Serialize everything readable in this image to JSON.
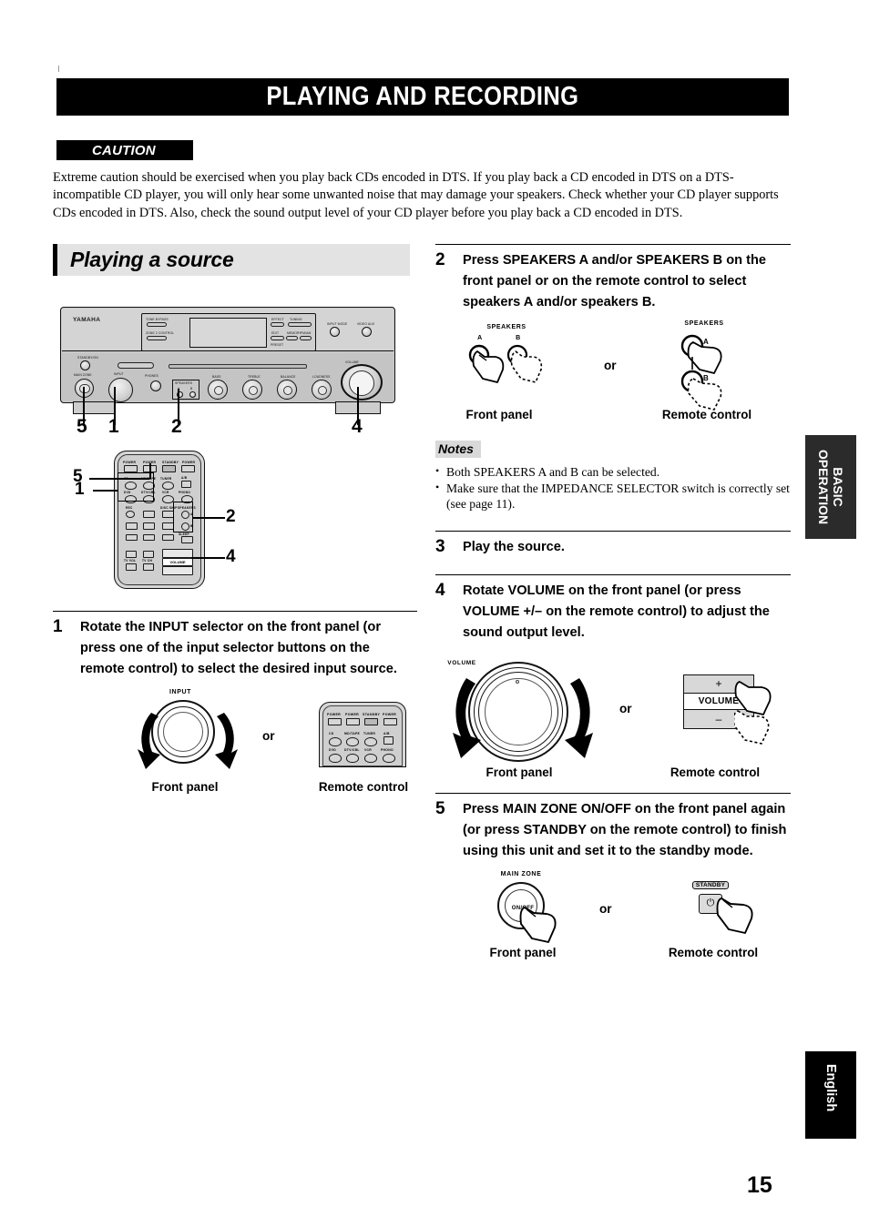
{
  "document": {
    "title": "PLAYING AND RECORDING",
    "page_number": "15"
  },
  "caution": {
    "label": "CAUTION",
    "body": "Extreme caution should be exercised when you play back CDs encoded in DTS. If you play back a CD encoded in DTS on a DTS-incompatible CD player, you will only hear some unwanted noise that may damage your speakers. Check whether your CD player supports CDs encoded in DTS. Also, check the sound output level of your CD player before you play back a CD encoded in DTS."
  },
  "section": {
    "heading": "Playing a source"
  },
  "receiver_figure": {
    "brand": "YAMAHA",
    "labels": {
      "standby_on": "STANDBY/ON",
      "main_zone": "MAIN ZONE",
      "on_off": "ON/OFF",
      "input": "INPUT",
      "phones": "PHONES",
      "speakers": "SPEAKERS",
      "speakers_a": "A",
      "speakers_b": "B",
      "bass": "BASS",
      "treble": "TREBLE",
      "balance": "BALANCE",
      "loudness": "LOUDNESS",
      "volume": "VOLUME",
      "input_mode": "INPUT MODE",
      "video_aux": "VIDEO AUX",
      "effect": "EFFECT",
      "memory": "MEMORY",
      "tuning": "TUNING",
      "preset": "PRESET",
      "edit": "EDIT",
      "fm_am": "FM/AM",
      "tone_bypass": "TONE BYPASS",
      "zone2_control": "ZONE 2 CONTROL"
    },
    "callouts": [
      "5",
      "1",
      "2",
      "4"
    ]
  },
  "remote_figure": {
    "callouts": [
      "5",
      "1",
      "2",
      "4"
    ],
    "buttons": {
      "power": "POWER",
      "tv": "TV",
      "av": "AV",
      "standby": "STANDBY",
      "power_unit": "POWER",
      "cd": "CD",
      "md_tape": "MD/TAPE",
      "tuner": "TUNER",
      "a_b": "A/B",
      "dvd": "DVD",
      "dtv_cbl": "DTV/CBL",
      "vcr": "VCR",
      "phono": "PHONO",
      "rec": "REC",
      "disc_skip": "DISC SKIP",
      "speakers": "SPEAKERS",
      "sleep": "SLEEP",
      "volume": "VOLUME",
      "tv_vol": "TV VOL",
      "tv_ch": "TV CH"
    }
  },
  "steps": [
    {
      "number": "1",
      "text": "Rotate the INPUT selector on the front panel (or press one of the input selector buttons on the remote control) to select the desired input source.",
      "figure": {
        "knob_label": "INPUT",
        "front_caption": "Front panel",
        "remote_caption": "Remote control",
        "or": "or"
      }
    },
    {
      "number": "2",
      "text": "Press SPEAKERS A and/or SPEAKERS B on the front panel or on the remote control to select speakers A and/or speakers B.",
      "figure": {
        "speakers_label": "SPEAKERS",
        "a": "A",
        "b": "B",
        "front_caption": "Front panel",
        "remote_caption": "Remote control",
        "or": "or"
      }
    },
    {
      "number": "3",
      "text": "Play the source."
    },
    {
      "number": "4",
      "text": "Rotate VOLUME on the front panel (or press VOLUME +/– on the remote control) to adjust the sound output level.",
      "figure": {
        "knob_label": "VOLUME",
        "plus": "+",
        "minus": "–",
        "rocker_label": "VOLUME",
        "front_caption": "Front panel",
        "remote_caption": "Remote control",
        "or": "or"
      }
    },
    {
      "number": "5",
      "text": "Press MAIN ZONE ON/OFF on the front panel again (or press STANDBY on the remote control) to finish using this unit and set it to the standby mode.",
      "figure": {
        "main_zone": "MAIN ZONE",
        "on_off": "ON/OFF",
        "standby": "STANDBY",
        "power_glyph": "⏻",
        "front_caption": "Front panel",
        "remote_caption": "Remote control",
        "or": "or"
      }
    }
  ],
  "notes": {
    "label": "Notes",
    "items": [
      "Both SPEAKERS A and B can be selected.",
      "Make sure that the IMPEDANCE SELECTOR switch is correctly set (see page 11)."
    ]
  },
  "side_tabs": {
    "basic_operation_line1": "BASIC",
    "basic_operation_line2": "OPERATION",
    "language": "English"
  }
}
